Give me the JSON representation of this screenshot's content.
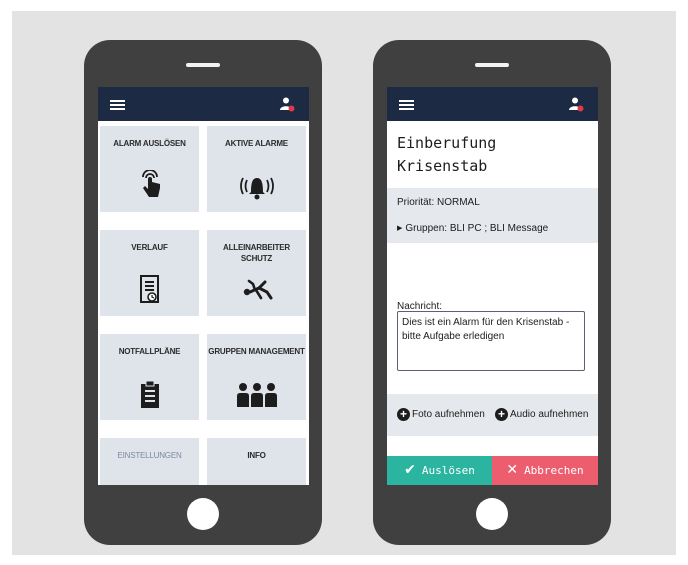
{
  "left_phone": {
    "tiles": [
      {
        "label": "ALARM AUSLÖSEN",
        "icon": "touch-hand-icon"
      },
      {
        "label": "AKTIVE ALARME",
        "icon": "alarm-bell-icon"
      },
      {
        "label": "VERLAUF",
        "icon": "history-document-icon"
      },
      {
        "label": "ALLEINARBEITER SCHUTZ",
        "icon": "falling-person-icon"
      },
      {
        "label": "NOTFALLPLÄNE",
        "icon": "clipboard-icon"
      },
      {
        "label": "GRUPPEN MANAGEMENT",
        "icon": "group-people-icon"
      },
      {
        "label": "EINSTELLUNGEN",
        "icon": ""
      },
      {
        "label": "INFO",
        "icon": ""
      }
    ]
  },
  "right_phone": {
    "title_line1": "Einberufung",
    "title_line2": "Krisenstab",
    "priority": "Priorität: NORMAL",
    "groups": "Gruppen:  BLI PC ; BLI Message",
    "message_label": "Nachricht:",
    "message_text": "Dies ist ein Alarm für den Krisenstab - bitte Aufgabe erledigen",
    "photo_label": "Foto aufnehmen",
    "audio_label": "Audio aufnehmen",
    "trigger_label": "Auslösen",
    "cancel_label": "Abbrechen"
  },
  "colors": {
    "appbar": "#1c2a44",
    "tile": "#dfe4ea",
    "trigger": "#2bb5a0",
    "cancel": "#ec5e6d",
    "phone_body": "#404040"
  }
}
